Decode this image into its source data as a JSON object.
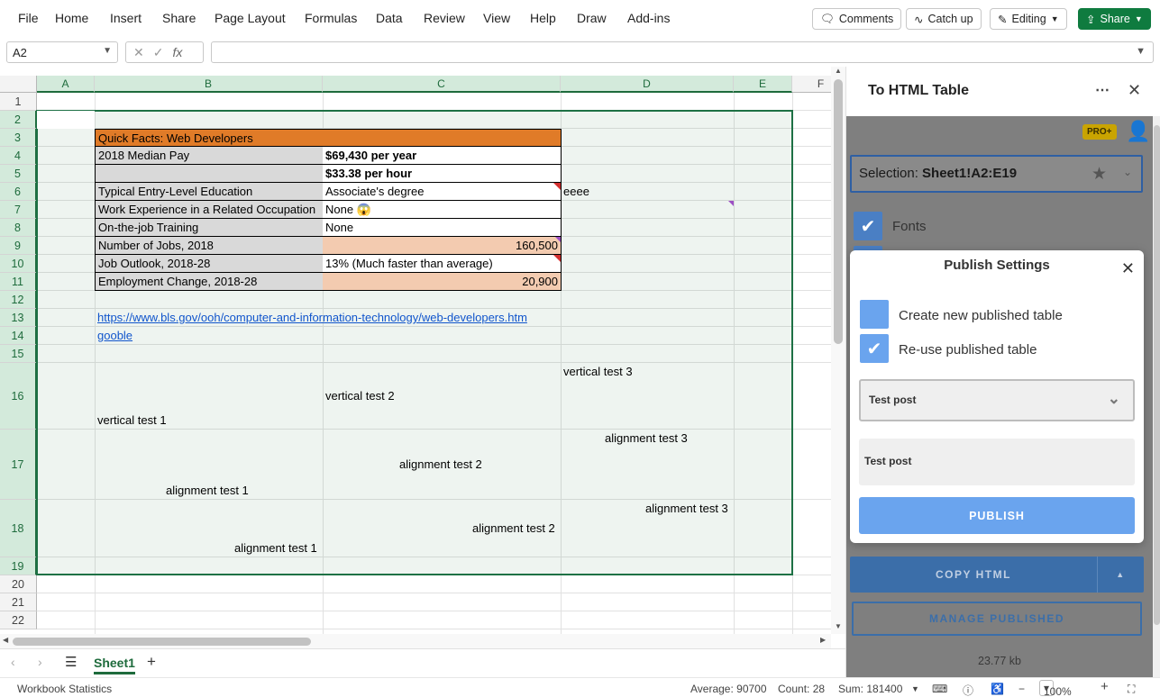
{
  "menu": [
    "File",
    "Home",
    "Insert",
    "Share",
    "Page Layout",
    "Formulas",
    "Data",
    "Review",
    "View",
    "Help",
    "Draw",
    "Add-ins"
  ],
  "toolbar": {
    "comments": "Comments",
    "catch_up": "Catch up",
    "editing": "Editing",
    "share": "Share"
  },
  "formula": {
    "name_box": "A2",
    "value": ""
  },
  "columns": [
    "A",
    "B",
    "C",
    "D",
    "E",
    "F"
  ],
  "rows": [
    "1",
    "2",
    "3",
    "4",
    "5",
    "6",
    "7",
    "8",
    "9",
    "10",
    "11",
    "12",
    "13",
    "14",
    "15",
    "16",
    "17",
    "18",
    "19",
    "20",
    "21",
    "22"
  ],
  "cells": {
    "b3": "Quick Facts: Web Developers",
    "b4": "2018 Median Pay",
    "c4": "$69,430 per year",
    "c5": "$33.38 per hour",
    "b6": "Typical Entry-Level Education",
    "c6": "Associate's degree",
    "d6": "eeee",
    "b7": "Work Experience in a Related Occupation",
    "c7": "None 😱",
    "b8": "On-the-job Training",
    "c8": "None",
    "b9": "Number of Jobs, 2018",
    "c9": "160,500",
    "b10": "Job Outlook, 2018-28",
    "c10": "13% (Much faster than average)",
    "b11": "Employment Change, 2018-28",
    "c11": "20,900",
    "b13": "https://www.bls.gov/ooh/computer-and-information-technology/web-developers.htm",
    "b14": "gooble",
    "d16": "vertical test 3",
    "c16": "vertical test 2",
    "b16": "vertical test 1",
    "d17": "alignment test 3",
    "c17": "alignment test 2",
    "b17": "alignment test 1",
    "d18": "alignment test 3",
    "c18": "alignment test 2",
    "b18": "alignment test 1"
  },
  "sheets": [
    "Sheet1"
  ],
  "status": {
    "left": "Workbook Statistics",
    "average": "Average: 90700",
    "count": "Count: 28",
    "sum": "Sum: 181400",
    "zoom": "100%"
  },
  "pane": {
    "title": "To HTML Table",
    "badge": "PRO+",
    "selection_label": "Selection:",
    "selection_value": "Sheet1!A2:E19",
    "fonts_label": "Fonts",
    "dialog": {
      "title": "Publish Settings",
      "option_new": "Create new published table",
      "option_reuse": "Re-use published table",
      "dropdown_value": "Test post",
      "text_value": "Test post",
      "publish_label": "PUBLISH"
    },
    "copy_html": "COPY HTML",
    "manage_published": "MANAGE PUBLISHED",
    "size": "23.77 kb"
  },
  "colors": {
    "accent_green": "#1e7145",
    "header_orange": "#e07b28",
    "label_gray": "#d9d9d9",
    "number_peach": "#f3cbb0",
    "pane_blue": "#6aa4ee"
  }
}
